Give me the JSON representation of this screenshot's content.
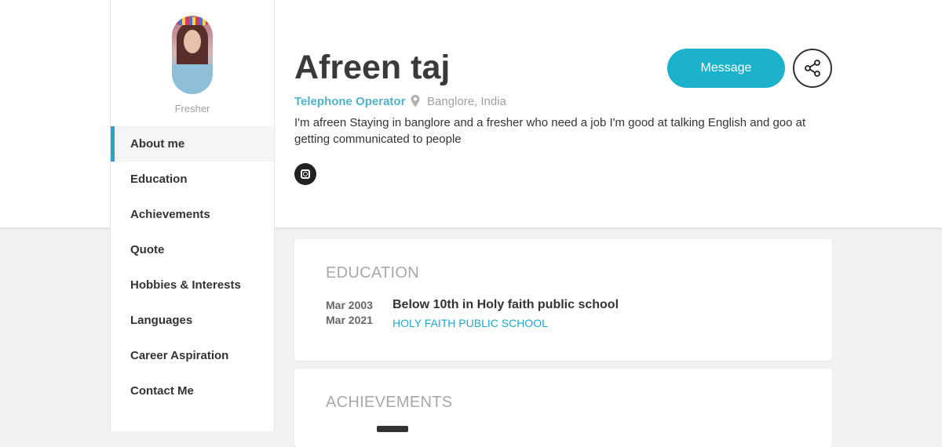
{
  "sidebar": {
    "subtitle": "Fresher",
    "items": [
      {
        "label": "About me"
      },
      {
        "label": "Education"
      },
      {
        "label": "Achievements"
      },
      {
        "label": "Quote"
      },
      {
        "label": "Hobbies & Interests"
      },
      {
        "label": "Languages"
      },
      {
        "label": "Career Aspiration"
      },
      {
        "label": "Contact Me"
      }
    ],
    "active_index": 0
  },
  "profile": {
    "name": "Afreen taj",
    "role": "Telephone Operator",
    "location": "Banglore, India",
    "bio": "I'm afreen Staying in banglore and a fresher who need a job I'm good at talking English and goo at getting communicated to people",
    "social_icon": "instagram-icon"
  },
  "actions": {
    "message_label": "Message",
    "share_icon": "share-icon"
  },
  "education": {
    "heading": "EDUCATION",
    "entries": [
      {
        "start": "Mar 2003",
        "end": "Mar 2021",
        "title": "Below 10th in Holy faith public school",
        "school": "HOLY FAITH PUBLIC SCHOOL"
      }
    ]
  },
  "achievements": {
    "heading": "ACHIEVEMENTS"
  },
  "colors": {
    "accent": "#1db2cc",
    "role": "#4fb3c9",
    "background": "#f2f2f2"
  }
}
